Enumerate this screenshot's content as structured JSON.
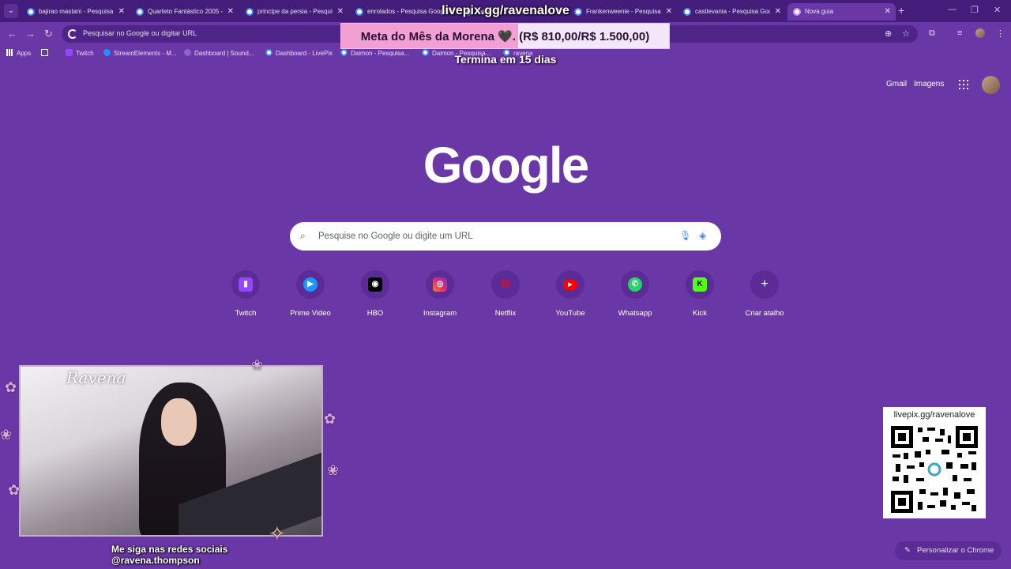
{
  "tabs": [
    {
      "title": "bajirao mastani - Pesquisa Google"
    },
    {
      "title": "Quarteto Fantástico 2005 - Pesquisa Google"
    },
    {
      "title": "principe da persia - Pesquisa Google"
    },
    {
      "title": "enrolados - Pesquisa Google"
    },
    {
      "title": "Daimon - Pesquisa Google"
    },
    {
      "title": "Frankenweenie - Pesquisa Google"
    },
    {
      "title": "castlevania - Pesquisa Google"
    },
    {
      "title": "Nova guia"
    }
  ],
  "active_tab_index": 7,
  "omnibox": {
    "placeholder": "Pesquisar no Google ou digitar URL"
  },
  "bookmarks": [
    {
      "label": "Apps"
    },
    {
      "label": "Twitch"
    },
    {
      "label": "StreamElements - M..."
    },
    {
      "label": "Dashboard | Sound..."
    },
    {
      "label": "Dashboard - LivePix"
    },
    {
      "label": "Daimon - Pesquisa..."
    },
    {
      "label": "Daimon - Pesquisa..."
    },
    {
      "label": "ravena"
    }
  ],
  "overlay": {
    "livepix_url": "livepix.gg/ravenalove",
    "goal_text": "Meta do Mês da Morena 🖤. (R$ 810,00/R$ 1.500,00)",
    "goal_progress": 0.54,
    "deadline": "Termina em 15 dias"
  },
  "header": {
    "gmail": "Gmail",
    "images": "Imagens"
  },
  "logo": "Google",
  "search": {
    "placeholder": "Pesquise no Google ou digite um URL"
  },
  "shortcuts": [
    {
      "label": "Twitch",
      "glyph": "▮",
      "color": "#9146ff"
    },
    {
      "label": "Prime Video",
      "glyph": "▶",
      "color": "#1a98ff"
    },
    {
      "label": "HBO",
      "glyph": "◉",
      "color": "#000000"
    },
    {
      "label": "Instagram",
      "glyph": "◎",
      "color": "#e1306c"
    },
    {
      "label": "Netflix",
      "glyph": "N",
      "color": "#b20710"
    },
    {
      "label": "YouTube",
      "glyph": "▶",
      "color": "#ff0000"
    },
    {
      "label": "Whatsapp",
      "glyph": "✆",
      "color": "#25d366"
    },
    {
      "label": "Kick",
      "glyph": "K",
      "color": "#53fc18"
    },
    {
      "label": "Criar atalho",
      "glyph": "+",
      "color": "transparent"
    }
  ],
  "stream": {
    "webcam_title": "Ravena",
    "follow_line1": "Me siga nas redes sociais",
    "follow_line2": "@ravena.thompson",
    "qr_title": "livepix.gg/ravenalove"
  },
  "customize_label": "Personalizar o Chrome"
}
